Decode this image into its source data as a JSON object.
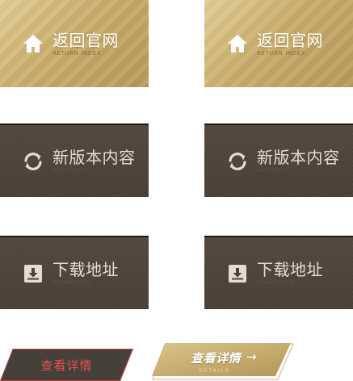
{
  "tiles": [
    {
      "title": "返回官网",
      "subtitle": "RETURN INDEX",
      "icon": "home-icon",
      "style": "gold"
    },
    {
      "title": "新版本内容",
      "subtitle": "ACTIVITY",
      "icon": "refresh-icon",
      "style": "dark"
    },
    {
      "title": "下载地址",
      "subtitle": "DOWNLOAD",
      "icon": "download-icon",
      "style": "dark"
    }
  ],
  "buttons": {
    "details_red": {
      "label": "查看详情"
    },
    "details_gold": {
      "label": "查看详情",
      "arrow": "→",
      "subtitle": "DETAILS"
    }
  },
  "colors": {
    "gold_light": "#e3cf94",
    "gold_dark": "#b8995a",
    "dark_tile": "#4f4439",
    "red_text": "#e8504e",
    "red_border": "#c0403c"
  }
}
